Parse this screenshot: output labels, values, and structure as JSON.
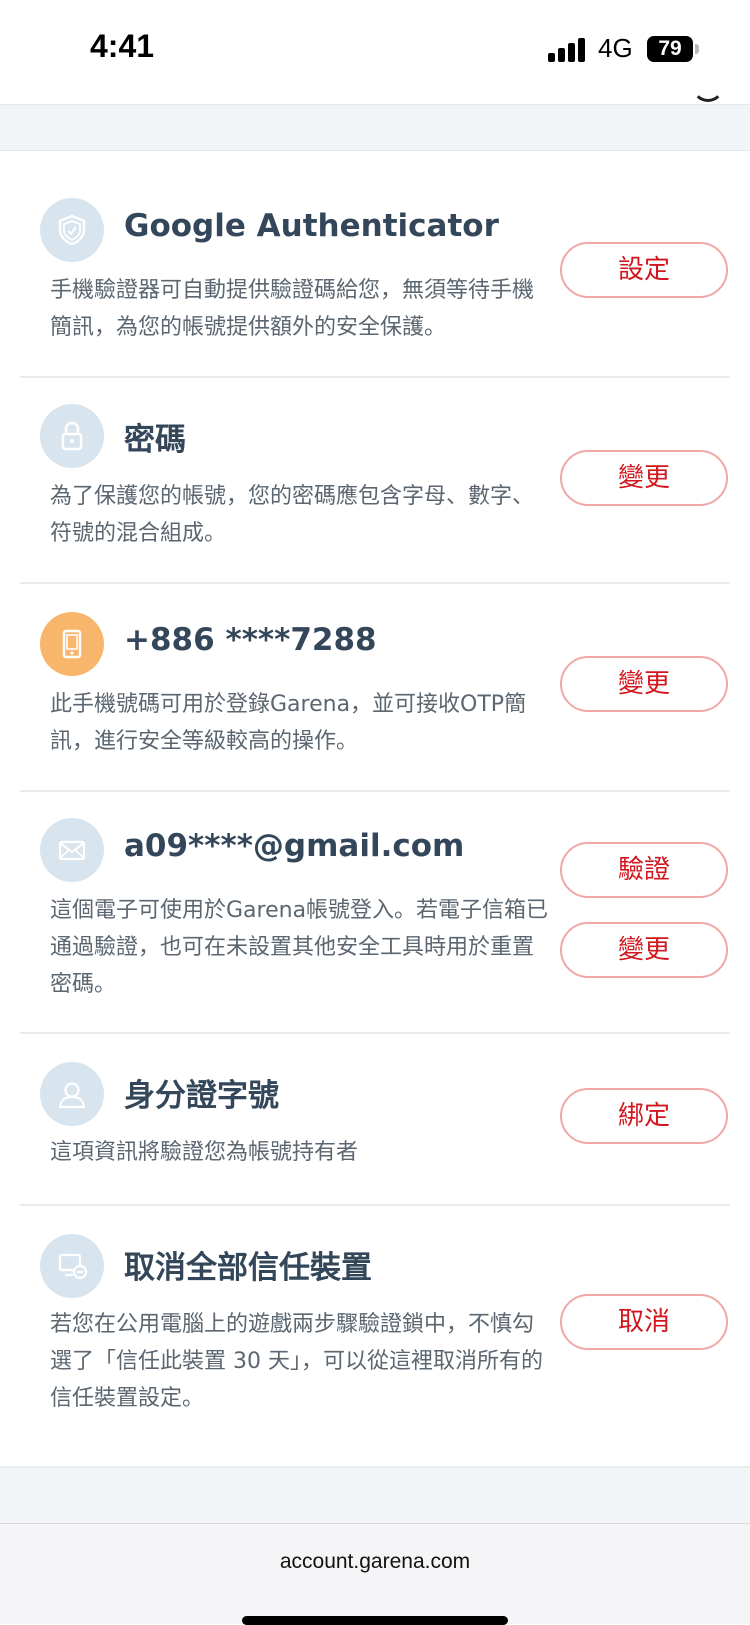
{
  "status": {
    "time": "4:41",
    "network": "4G",
    "battery": "79"
  },
  "items": [
    {
      "title": "Google Authenticator",
      "desc": "手機驗證器可自動提供驗證碼給您，無須等待手機簡訊，為您的帳號提供額外的安全保護。",
      "buttons": [
        "設定"
      ],
      "icon": "shield-icon"
    },
    {
      "title": "密碼",
      "desc": "為了保護您的帳號，您的密碼應包含字母、數字、符號的混合組成。",
      "buttons": [
        "變更"
      ],
      "icon": "lock-icon"
    },
    {
      "title": "+886 ****7288",
      "desc": "此手機號碼可用於登錄Garena，並可接收OTP簡訊，進行安全等級較高的操作。",
      "buttons": [
        "變更"
      ],
      "icon": "phone-icon"
    },
    {
      "title": "a09****@gmail.com",
      "desc": "這個電子可使用於Garena帳號登入。若電子信箱已通過驗證，也可在未設置其他安全工具時用於重置密碼。",
      "buttons": [
        "驗證",
        "變更"
      ],
      "icon": "mail-icon"
    },
    {
      "title": "身分證字號",
      "desc": "這項資訊將驗證您為帳號持有者",
      "buttons": [
        "綁定"
      ],
      "icon": "id-person-icon"
    },
    {
      "title": "取消全部信任裝置",
      "desc": "若您在公用電腦上的遊戲兩步驟驗證鎖中，不慎勾選了「信任此裝置 30 天」，可以從這裡取消所有的信任裝置設定。",
      "buttons": [
        "取消"
      ],
      "icon": "device-remove-icon"
    }
  ],
  "browser": {
    "url": "account.garena.com"
  },
  "colors": {
    "accent": "#d2161e",
    "button_border": "#f0a7a7",
    "icon_bg": "#d9e5ee",
    "phone_icon_bg": "#f8b66c"
  }
}
